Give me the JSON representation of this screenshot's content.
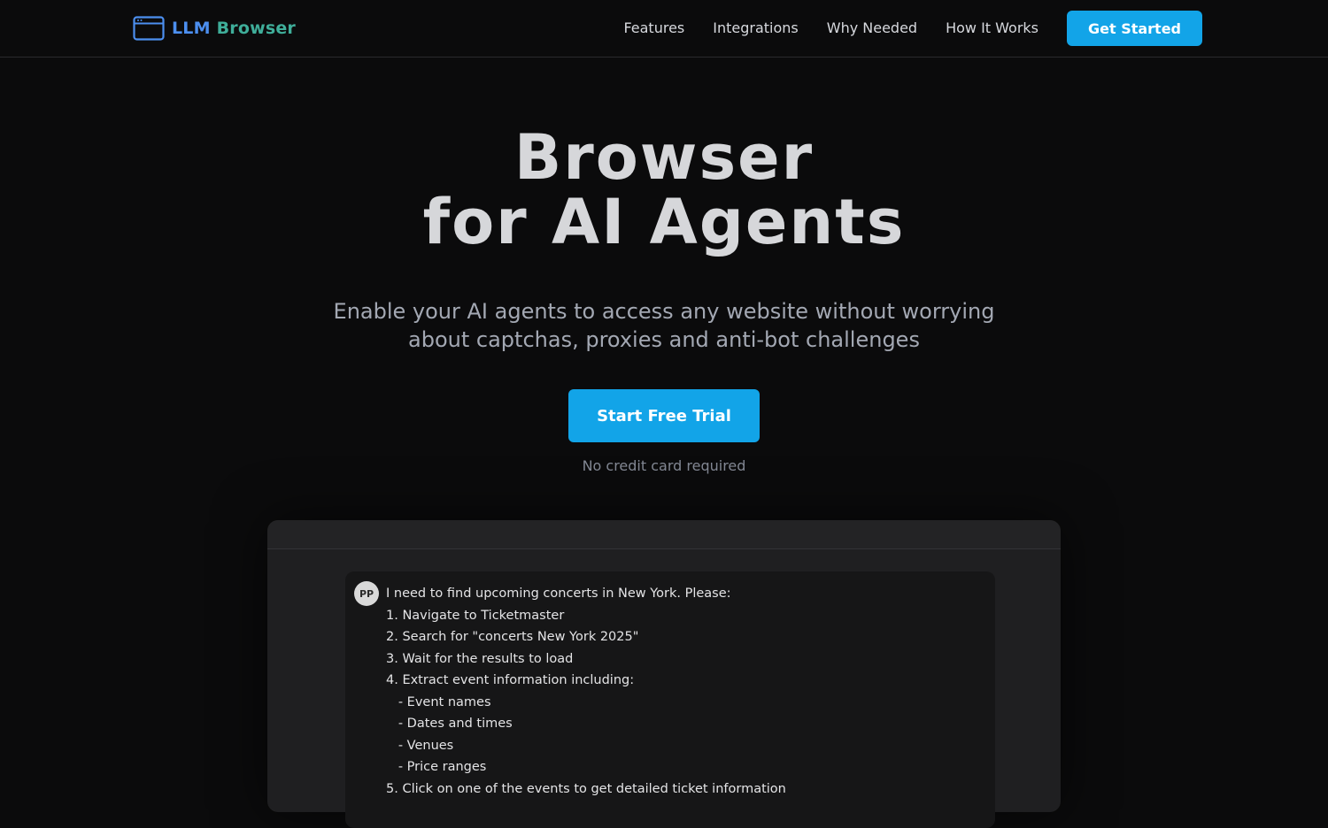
{
  "nav": {
    "logo_part1": "LLM",
    "logo_part2": "Browser",
    "logo_icon": "browser-window-icon",
    "links": [
      "Features",
      "Integrations",
      "Why Needed",
      "How It Works"
    ],
    "cta_label": "Get Started"
  },
  "hero": {
    "title_line1": "Browser",
    "title_line2": "for AI Agents",
    "subtitle_line1": "Enable your AI agents to access any website without worrying",
    "subtitle_line2": "about captchas, proxies and anti-bot challenges",
    "trial_label": "Start Free Trial",
    "note": "No credit card required"
  },
  "demo": {
    "avatar_initials": "PP",
    "message_lines": [
      "I need to find upcoming concerts in New York. Please:",
      "1. Navigate to Ticketmaster",
      "2. Search for \"concerts New York 2025\"",
      "3. Wait for the results to load",
      "4. Extract event information including:",
      "   - Event names",
      "   - Dates and times",
      "   - Venues",
      "   - Price ranges",
      "5. Click on one of the events to get detailed ticket information"
    ]
  },
  "colors": {
    "accent": "#12a4e8",
    "logo_blue": "#4c8ff0",
    "logo_green": "#3fae9a",
    "background": "#0b0b0c"
  }
}
